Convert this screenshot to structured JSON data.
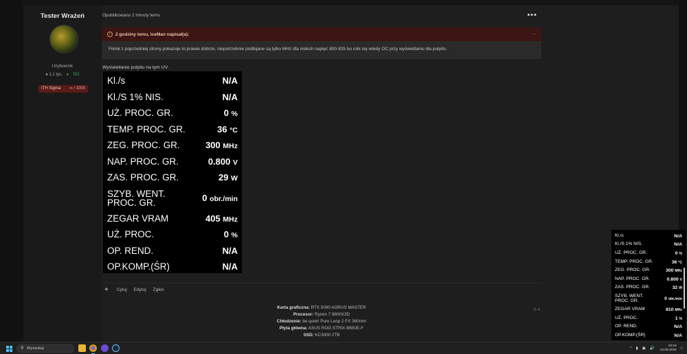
{
  "author": {
    "name": "Tester Wrażeń",
    "role": "Użytkownik",
    "posts": "1,1 tys.",
    "reputation": "781",
    "rank": "ITH Sigma",
    "rank_points": "∞ / 1000"
  },
  "post": {
    "date": "Opublikowano 2 minuty temu",
    "quote_header": "2 godziny temu, IceMan napisał(a):",
    "quote_text": "Filmik z poprzedniej strony pokazuje to prawie dobrze, niepotrzebnie podbijane są tylko MHz dla niskich napięć 800-825 bo robi się wtedy OC przy wyświetlaniu dla pulpitu.",
    "body_text": "Wyświetlanie pulpitu na tym UV."
  },
  "osd_big": [
    {
      "label": "Kl./s",
      "value": "N/A",
      "unit": ""
    },
    {
      "label": "Kl./S 1% NIS.",
      "value": "N/A",
      "unit": ""
    },
    {
      "label": "UŻ. PROC. GR.",
      "value": "0",
      "unit": "%"
    },
    {
      "label": "TEMP. PROC. GR.",
      "value": "36",
      "unit": "°C"
    },
    {
      "label": "ZEG. PROC. GR.",
      "value": "300",
      "unit": "MHz"
    },
    {
      "label": "NAP. PROC. GR.",
      "value": "0.800",
      "unit": "V"
    },
    {
      "label": "ZAS. PROC. GR.",
      "value": "29",
      "unit": "W"
    },
    {
      "label": "SZYB. WENT. PROC. GR.",
      "value": "0",
      "unit": "obr./min"
    },
    {
      "label": "ZEGAR VRAM",
      "value": "405",
      "unit": "MHz"
    },
    {
      "label": "UŻ. PROC.",
      "value": "0",
      "unit": "%"
    },
    {
      "label": "OP. REND.",
      "value": "N/A",
      "unit": ""
    },
    {
      "label": "OP.KOMP.(ŚR)",
      "value": "N/A",
      "unit": ""
    }
  ],
  "osd_small": [
    {
      "label": "Kl./s",
      "value": "N/A",
      "unit": ""
    },
    {
      "label": "Kl./S 1% NIS.",
      "value": "N/A",
      "unit": ""
    },
    {
      "label": "UŻ. PROC. GR.",
      "value": "0",
      "unit": "%"
    },
    {
      "label": "TEMP. PROC. GR.",
      "value": "36",
      "unit": "°C"
    },
    {
      "label": "ZEG. PROC. GR.",
      "value": "300",
      "unit": "MHz"
    },
    {
      "label": "NAP. PROC. GR.",
      "value": "0.800",
      "unit": "V"
    },
    {
      "label": "ZAS. PROC. GR.",
      "value": "32",
      "unit": "W"
    },
    {
      "label": "SZYB. WENT. PROC. GR.",
      "value": "0",
      "unit": "obr./min"
    },
    {
      "label": "ZEGAR VRAM",
      "value": "810",
      "unit": "MHz"
    },
    {
      "label": "UŻ. PROC.",
      "value": "1",
      "unit": "%"
    },
    {
      "label": "OP. REND.",
      "value": "N/A",
      "unit": ""
    },
    {
      "label": "OP.KOMP.(ŚR)",
      "value": "N/A",
      "unit": ""
    }
  ],
  "actions": {
    "add": "+",
    "quote": "Cytuj",
    "edit": "Edytuj",
    "report": "Zgłoś"
  },
  "signature": [
    {
      "label": "Karta graficzna:",
      "value": "RTX 5090 AORUS MASTER"
    },
    {
      "label": "Procesor:",
      "value": "Ryzen 7 9800X3D"
    },
    {
      "label": "Chłodzenie:",
      "value": "be quiet! Pure Loop 2 FX 360mm"
    },
    {
      "label": "Płyta główna:",
      "value": "ASUS ROG STRIX B650E-F"
    },
    {
      "label": "SSD:",
      "value": "KC3000 2TB"
    }
  ],
  "taskbar": {
    "search_placeholder": "Wyszukaj",
    "time": "10:16",
    "date": "10.05.2025",
    "chevron": "^"
  },
  "colors": {
    "quote_header_bg": "#3c1515",
    "rank_badge_bg": "#5a1a16",
    "reputation_green": "#45a46a",
    "windows_blue": "#4cc2ff"
  }
}
